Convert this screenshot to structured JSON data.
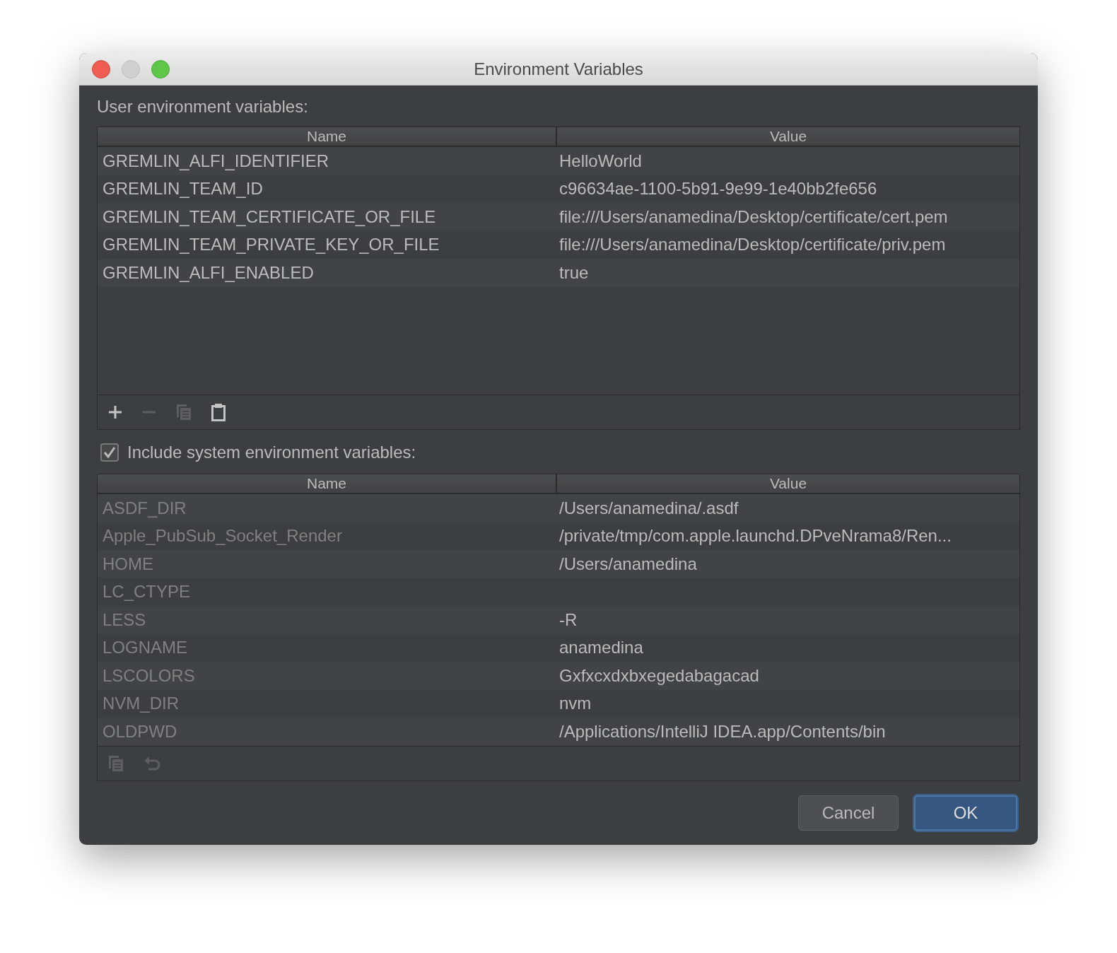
{
  "window": {
    "title": "Environment Variables"
  },
  "user_section": {
    "label": "User environment variables:",
    "columns": [
      "Name",
      "Value"
    ],
    "rows": [
      {
        "name": "GREMLIN_ALFI_IDENTIFIER",
        "value": "HelloWorld"
      },
      {
        "name": "GREMLIN_TEAM_ID",
        "value": "c96634ae-1100-5b91-9e99-1e40bb2fe656"
      },
      {
        "name": "GREMLIN_TEAM_CERTIFICATE_OR_FILE",
        "value": "file:///Users/anamedina/Desktop/certificate/cert.pem"
      },
      {
        "name": "GREMLIN_TEAM_PRIVATE_KEY_OR_FILE",
        "value": "file:///Users/anamedina/Desktop/certificate/priv.pem"
      },
      {
        "name": "GREMLIN_ALFI_ENABLED",
        "value": "true"
      }
    ],
    "toolbar": [
      {
        "kind": "add",
        "disabled": false
      },
      {
        "kind": "remove",
        "disabled": true
      },
      {
        "kind": "copy",
        "disabled": true
      },
      {
        "kind": "paste",
        "disabled": false
      }
    ]
  },
  "system_section": {
    "label": "Include system environment variables:",
    "checked": true,
    "columns": [
      "Name",
      "Value"
    ],
    "rows": [
      {
        "name": "ASDF_DIR",
        "value": "/Users/anamedina/.asdf"
      },
      {
        "name": "Apple_PubSub_Socket_Render",
        "value": "/private/tmp/com.apple.launchd.DPveNrama8/Ren..."
      },
      {
        "name": "HOME",
        "value": "/Users/anamedina"
      },
      {
        "name": "LC_CTYPE",
        "value": ""
      },
      {
        "name": "LESS",
        "value": "-R"
      },
      {
        "name": "LOGNAME",
        "value": "anamedina"
      },
      {
        "name": "LSCOLORS",
        "value": "Gxfxcxdxbxegedabagacad"
      },
      {
        "name": "NVM_DIR",
        "value": "nvm"
      },
      {
        "name": "OLDPWD",
        "value": "/Applications/IntelliJ IDEA.app/Contents/bin"
      }
    ],
    "toolbar": [
      {
        "kind": "copy",
        "disabled": true
      },
      {
        "kind": "undo",
        "disabled": true
      }
    ]
  },
  "buttons": [
    {
      "label": "Cancel",
      "kind": "secondary"
    },
    {
      "label": "OK",
      "kind": "primary"
    }
  ]
}
